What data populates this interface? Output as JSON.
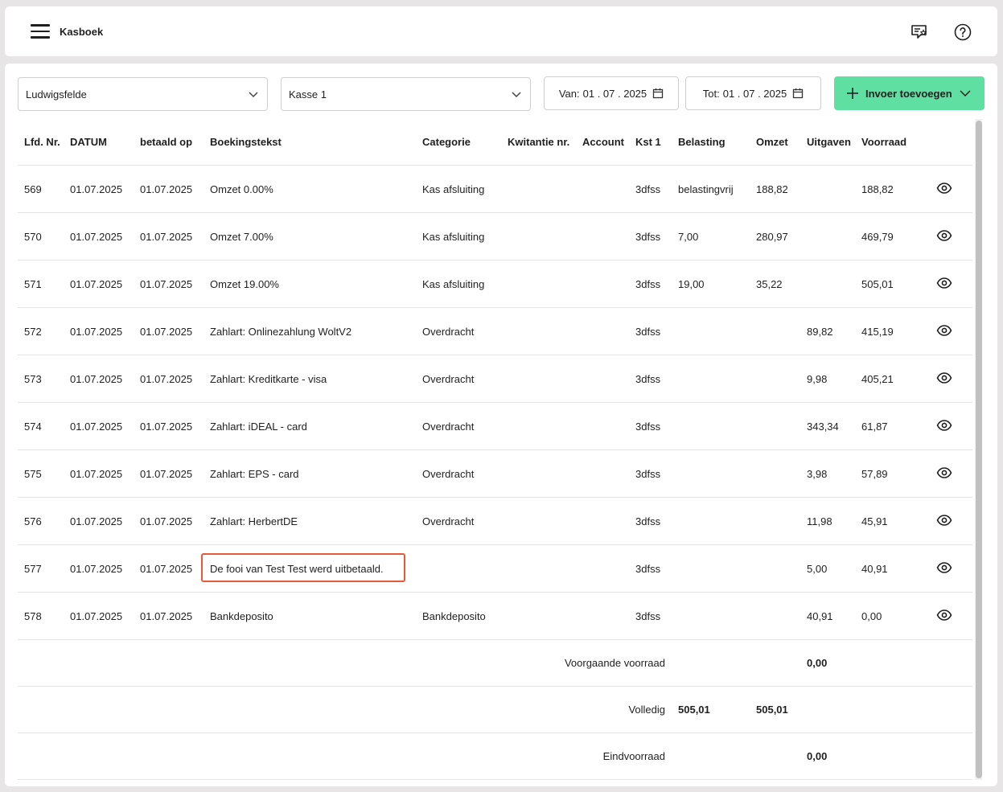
{
  "header": {
    "title": "Kasboek"
  },
  "filters": {
    "location": "Ludwigsfelde",
    "register": "Kasse 1",
    "from_label": "Van:",
    "from_date": "01 . 07 . 2025",
    "to_label": "Tot:",
    "to_date": "01 . 07 . 2025",
    "add_button": "Invoer toevoegen"
  },
  "table": {
    "columns": [
      "Lfd. Nr.",
      "DATUM",
      "betaald op",
      "Boekingstekst",
      "Categorie",
      "Kwitantie nr.",
      "Account",
      "Kst 1",
      "Belasting",
      "Omzet",
      "Uitgaven",
      "Voorraad"
    ],
    "rows": [
      {
        "nr": "569",
        "datum": "01.07.2025",
        "betaald": "01.07.2025",
        "tekst": "Omzet 0.00%",
        "categorie": "Kas afsluiting",
        "kwitantie": "",
        "account": "",
        "kst": "3dfss",
        "belasting": "belastingvrij",
        "omzet": "188,82",
        "uitgaven": "",
        "voorraad": "188,82"
      },
      {
        "nr": "570",
        "datum": "01.07.2025",
        "betaald": "01.07.2025",
        "tekst": "Omzet 7.00%",
        "categorie": "Kas afsluiting",
        "kwitantie": "",
        "account": "",
        "kst": "3dfss",
        "belasting": "7,00",
        "omzet": "280,97",
        "uitgaven": "",
        "voorraad": "469,79"
      },
      {
        "nr": "571",
        "datum": "01.07.2025",
        "betaald": "01.07.2025",
        "tekst": "Omzet 19.00%",
        "categorie": "Kas afsluiting",
        "kwitantie": "",
        "account": "",
        "kst": "3dfss",
        "belasting": "19,00",
        "omzet": "35,22",
        "uitgaven": "",
        "voorraad": "505,01"
      },
      {
        "nr": "572",
        "datum": "01.07.2025",
        "betaald": "01.07.2025",
        "tekst": "Zahlart: Onlinezahlung WoltV2",
        "categorie": "Overdracht",
        "kwitantie": "",
        "account": "",
        "kst": "3dfss",
        "belasting": "",
        "omzet": "",
        "uitgaven": "89,82",
        "voorraad": "415,19"
      },
      {
        "nr": "573",
        "datum": "01.07.2025",
        "betaald": "01.07.2025",
        "tekst": "Zahlart: Kreditkarte - visa",
        "categorie": "Overdracht",
        "kwitantie": "",
        "account": "",
        "kst": "3dfss",
        "belasting": "",
        "omzet": "",
        "uitgaven": "9,98",
        "voorraad": "405,21"
      },
      {
        "nr": "574",
        "datum": "01.07.2025",
        "betaald": "01.07.2025",
        "tekst": "Zahlart: iDEAL - card",
        "categorie": "Overdracht",
        "kwitantie": "",
        "account": "",
        "kst": "3dfss",
        "belasting": "",
        "omzet": "",
        "uitgaven": "343,34",
        "voorraad": "61,87"
      },
      {
        "nr": "575",
        "datum": "01.07.2025",
        "betaald": "01.07.2025",
        "tekst": "Zahlart: EPS - card",
        "categorie": "Overdracht",
        "kwitantie": "",
        "account": "",
        "kst": "3dfss",
        "belasting": "",
        "omzet": "",
        "uitgaven": "3,98",
        "voorraad": "57,89"
      },
      {
        "nr": "576",
        "datum": "01.07.2025",
        "betaald": "01.07.2025",
        "tekst": "Zahlart: HerbertDE",
        "categorie": "Overdracht",
        "kwitantie": "",
        "account": "",
        "kst": "3dfss",
        "belasting": "",
        "omzet": "",
        "uitgaven": "11,98",
        "voorraad": "45,91"
      },
      {
        "nr": "577",
        "datum": "01.07.2025",
        "betaald": "01.07.2025",
        "tekst": "De fooi van Test Test werd uitbetaald.",
        "categorie": "",
        "kwitantie": "",
        "account": "",
        "kst": "3dfss",
        "belasting": "",
        "omzet": "",
        "uitgaven": "5,00",
        "voorraad": "40,91",
        "highlight": true
      },
      {
        "nr": "578",
        "datum": "01.07.2025",
        "betaald": "01.07.2025",
        "tekst": "Bankdeposito",
        "categorie": "Bankdeposito",
        "kwitantie": "",
        "account": "",
        "kst": "3dfss",
        "belasting": "",
        "omzet": "",
        "uitgaven": "40,91",
        "voorraad": "0,00"
      }
    ],
    "summary": {
      "previous_label": "Voorgaande voorraad",
      "previous_value": "0,00",
      "total_label": "Volledig",
      "total_belasting": "505,01",
      "total_omzet": "505,01",
      "end_label": "Eindvoorraad",
      "end_value": "0,00"
    }
  },
  "colors": {
    "accent": "#5fe0a2",
    "highlight": "#e8583a"
  }
}
